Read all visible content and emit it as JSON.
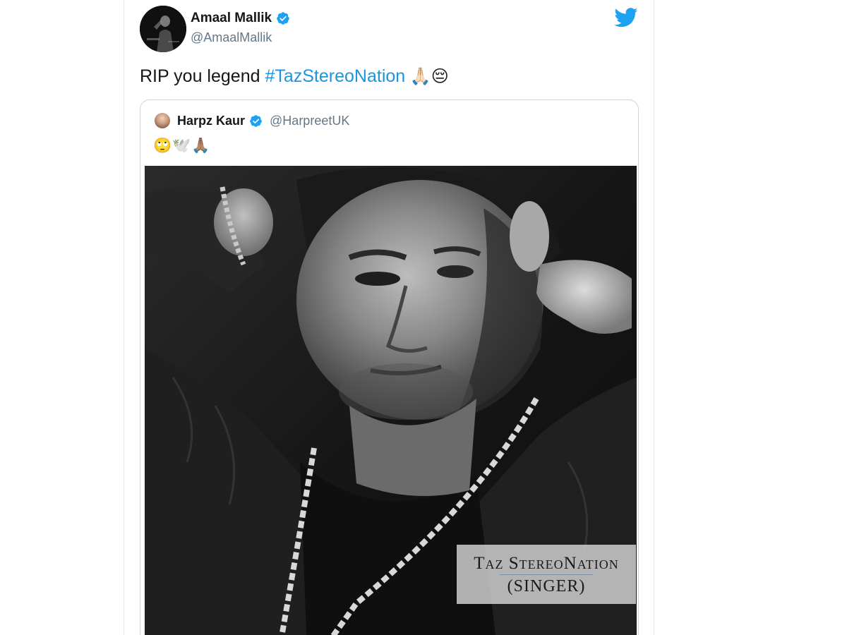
{
  "tweet": {
    "author_name": "Amaal Mallik",
    "author_handle": "@AmaalMallik",
    "text_before": "RIP you legend ",
    "hashtag": "#TazStereoNation",
    "text_emojis": " 🙏🏻😔",
    "avatar_icon": "user-avatar-icon",
    "verified_icon": "verified-badge-icon",
    "platform_icon": "twitter-bird-icon"
  },
  "quoted_tweet": {
    "author_name": "Harpz Kaur",
    "author_handle": "@HarpreetUK",
    "text": "🙄🕊️🙏🏽",
    "image": {
      "caption_title": "Taz StereoNation",
      "caption_sub": "(SINGER)"
    }
  },
  "colors": {
    "hashtag": "#1b95e0",
    "verified": "#1da1f2",
    "twitter_brand": "#1da1f2",
    "secondary_text": "#657786",
    "border": "#ccd6dd"
  }
}
